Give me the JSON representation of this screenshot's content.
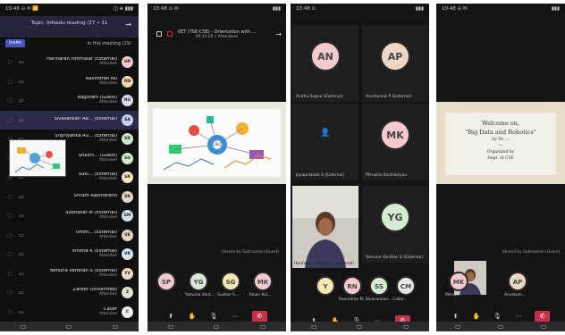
{
  "phone1": {
    "status": {
      "left": "10:48 ⊙ ✉ 📶",
      "right": "◫ ⊕ ▮▮▮"
    },
    "title": "Topic: Infoedu reading (27 ∙ 11",
    "invite": "Invite",
    "section": "In this meeting (19)",
    "participants": [
      {
        "name": "Hariharan Ponmalar (External)",
        "role": "Attendee",
        "initials": "HP",
        "color": "#f6c9cf"
      },
      {
        "name": "Ravindran Nu",
        "role": "Attendee",
        "initials": "RN",
        "color": "#f2d6b3"
      },
      {
        "name": "Raguram (Guest)",
        "role": "Attendee",
        "initials": "RG",
        "color": "#dfd6f0"
      },
      {
        "name": "Sivasankari Ab... (External)",
        "role": "",
        "initials": "SA",
        "color": "#c8d2f0"
      },
      {
        "name": "Sripriyanka Ru... (External)",
        "role": "Attendee",
        "initials": "SR",
        "color": "#cfe6cf"
      },
      {
        "name": "Shalini... (Guest)",
        "role": "Attendee",
        "initials": "SG",
        "color": "#d6ecd2"
      },
      {
        "name": "Suki... (External)",
        "role": "Attendee",
        "initials": "SK",
        "color": "#f6e3bf"
      },
      {
        "name": "Sriram Ravindrann",
        "role": "",
        "initials": "SR",
        "color": "#e4d4c8"
      },
      {
        "name": "Sudhakar M (External)",
        "role": "Attendee",
        "initials": "SM",
        "color": "#d2e0ee"
      },
      {
        "name": "Umm... (External)",
        "role": "Attendee",
        "initials": "UE",
        "color": "#e2d8c6"
      },
      {
        "name": "Vinitha K (External)",
        "role": "Attendee",
        "initials": "VK",
        "color": "#d6e6ee"
      },
      {
        "name": "Yamuna Vardhan S (External)",
        "role": "Attendee",
        "initials": "YV",
        "color": "#ecdec6"
      },
      {
        "name": "Zareef (Unverified)",
        "role": "Attendee",
        "initials": "Z",
        "color": "#dde6d2"
      },
      {
        "name": "Caller",
        "role": "Attendee",
        "initials": "C",
        "color": "#eeeeee"
      }
    ]
  },
  "phone2": {
    "status": {
      "left": "10:48 ⊙ ✉",
      "right": "▮▮▮"
    },
    "title": "VET (TSE-CSE) - Orientation with ...",
    "subtitle": "00:14:28 • Attendees",
    "caption": "Shared by Subhashini (Guest)",
    "avatars": [
      {
        "initials": "MK",
        "color": "#f6c9cf",
        "label": "Kavin Kul..."
      },
      {
        "initials": "SG",
        "color": "#f6e7b3",
        "label": "Sudhar S..."
      },
      {
        "initials": "YG",
        "color": "#d5ecd2",
        "label": "Yamuna Vard..."
      },
      {
        "initials": "SP",
        "color": "#f6c9cf",
        "label": ""
      }
    ]
  },
  "phone3": {
    "status": {
      "left": "10:48 ⊙",
      "right": "▮▮▮"
    },
    "tiles": [
      {
        "initials": "AP",
        "color": "#ecd7c6",
        "label": "Arunkumar P (External)"
      },
      {
        "initials": "AN",
        "color": "#f6c9cf",
        "label": "Anitha Sugnu (External)"
      },
      {
        "initials": "MK",
        "color": "#f6c9cf",
        "label": "Mirnalini Karthikeyan"
      },
      {
        "initials": "",
        "color": "#2a2a2a",
        "label": "Jayaprakash S (External)"
      },
      {
        "initials": "YG",
        "color": "#d5ecd2",
        "label": "Yamuna Vardhan S (External)"
      },
      {
        "initials": "",
        "color": "#2a2a2a",
        "label": "Hariharan Ponmalar (External)"
      }
    ],
    "avatars": [
      {
        "initials": "CM",
        "color": "#e6e6e6",
        "label": "Caller..."
      },
      {
        "initials": "SS",
        "color": "#d5ecd2",
        "label": "Sivasankari..."
      },
      {
        "initials": "RN",
        "color": "#f6c9cf",
        "label": "Ravindran N..."
      },
      {
        "initials": "Y",
        "color": "#f6e7b3",
        "label": ""
      }
    ]
  },
  "phone4": {
    "status": {
      "left": "10:48 ⊙ ✉",
      "right": "▮▮▮"
    },
    "slide_lines": [
      "Welcome on,",
      "\"Big Data and Robotics\"",
      "by Dr. ...",
      "—",
      "Organized by",
      "Dept. of CSE"
    ],
    "caption": "Shared by Subhashini (Guest)",
    "avatars": [
      {
        "initials": "AP",
        "color": "#ecd7c6",
        "label": "Arunkum..."
      },
      {
        "initials": "MK",
        "color": "#f6c9cf",
        "label": "Mirnali..."
      },
      {
        "initials": "S",
        "color": "#d5ecd2",
        "label": ""
      }
    ]
  },
  "colors": {
    "accent": "#4b53bc",
    "hangup": "#c4314b",
    "background": "#141414"
  }
}
